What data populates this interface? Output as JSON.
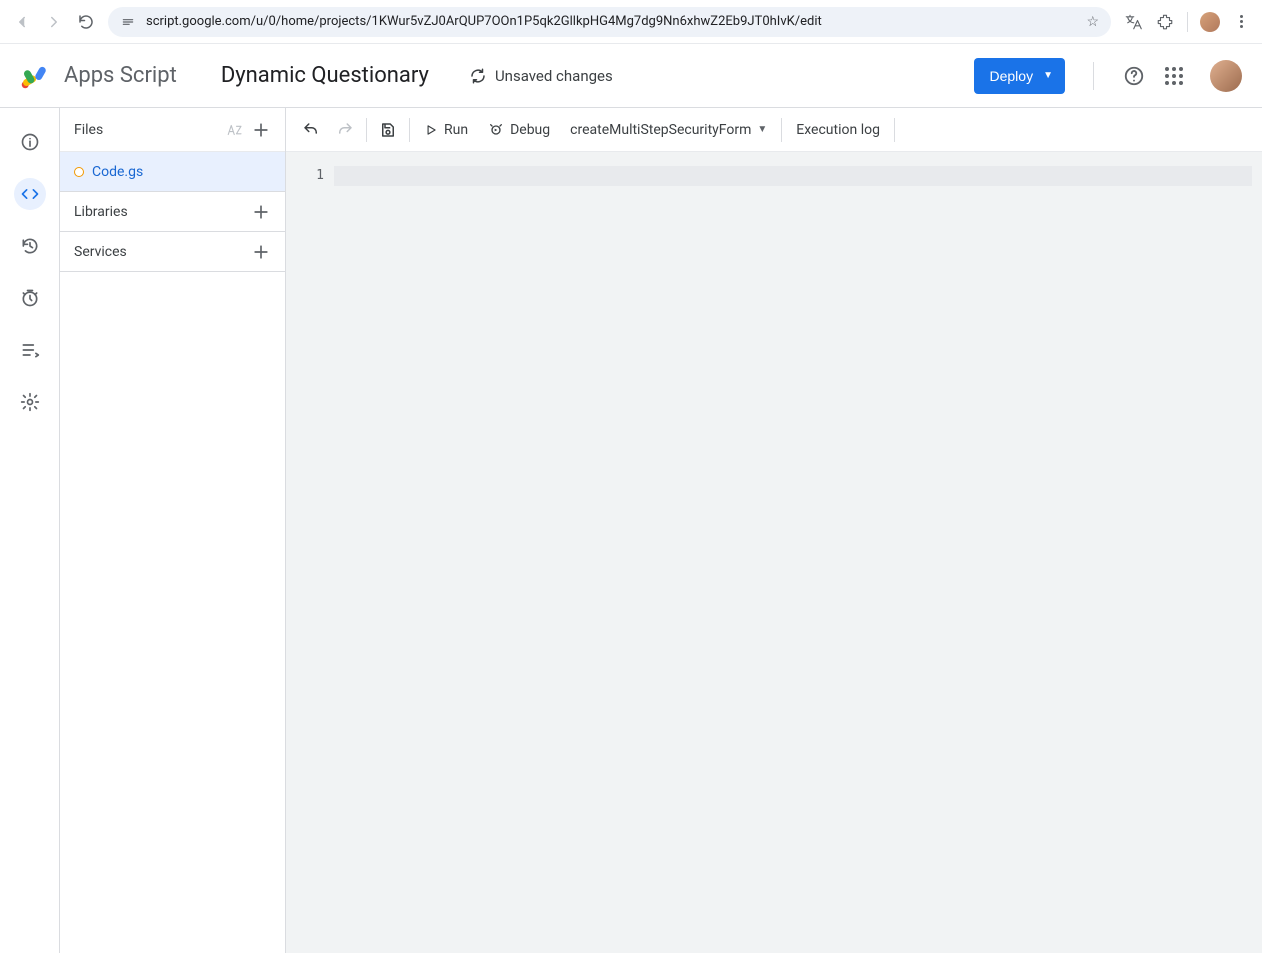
{
  "browser": {
    "url": "script.google.com/u/0/home/projects/1KWur5vZJ0ArQUP7OOn1P5qk2GllkpHG4Mg7dg9Nn6xhwZ2Eb9JT0hIvK/edit"
  },
  "header": {
    "product_name": "Apps Script",
    "project_title": "Dynamic Questionary",
    "unsaved_label": "Unsaved changes",
    "deploy_label": "Deploy"
  },
  "filePanel": {
    "files_header": "Files",
    "file_name": "Code.gs",
    "libraries_label": "Libraries",
    "services_label": "Services"
  },
  "toolbar": {
    "run_label": "Run",
    "debug_label": "Debug",
    "function_selected": "createMultiStepSecurityForm",
    "execution_log_label": "Execution log"
  },
  "editor": {
    "line_number": "1",
    "line_content": ""
  }
}
